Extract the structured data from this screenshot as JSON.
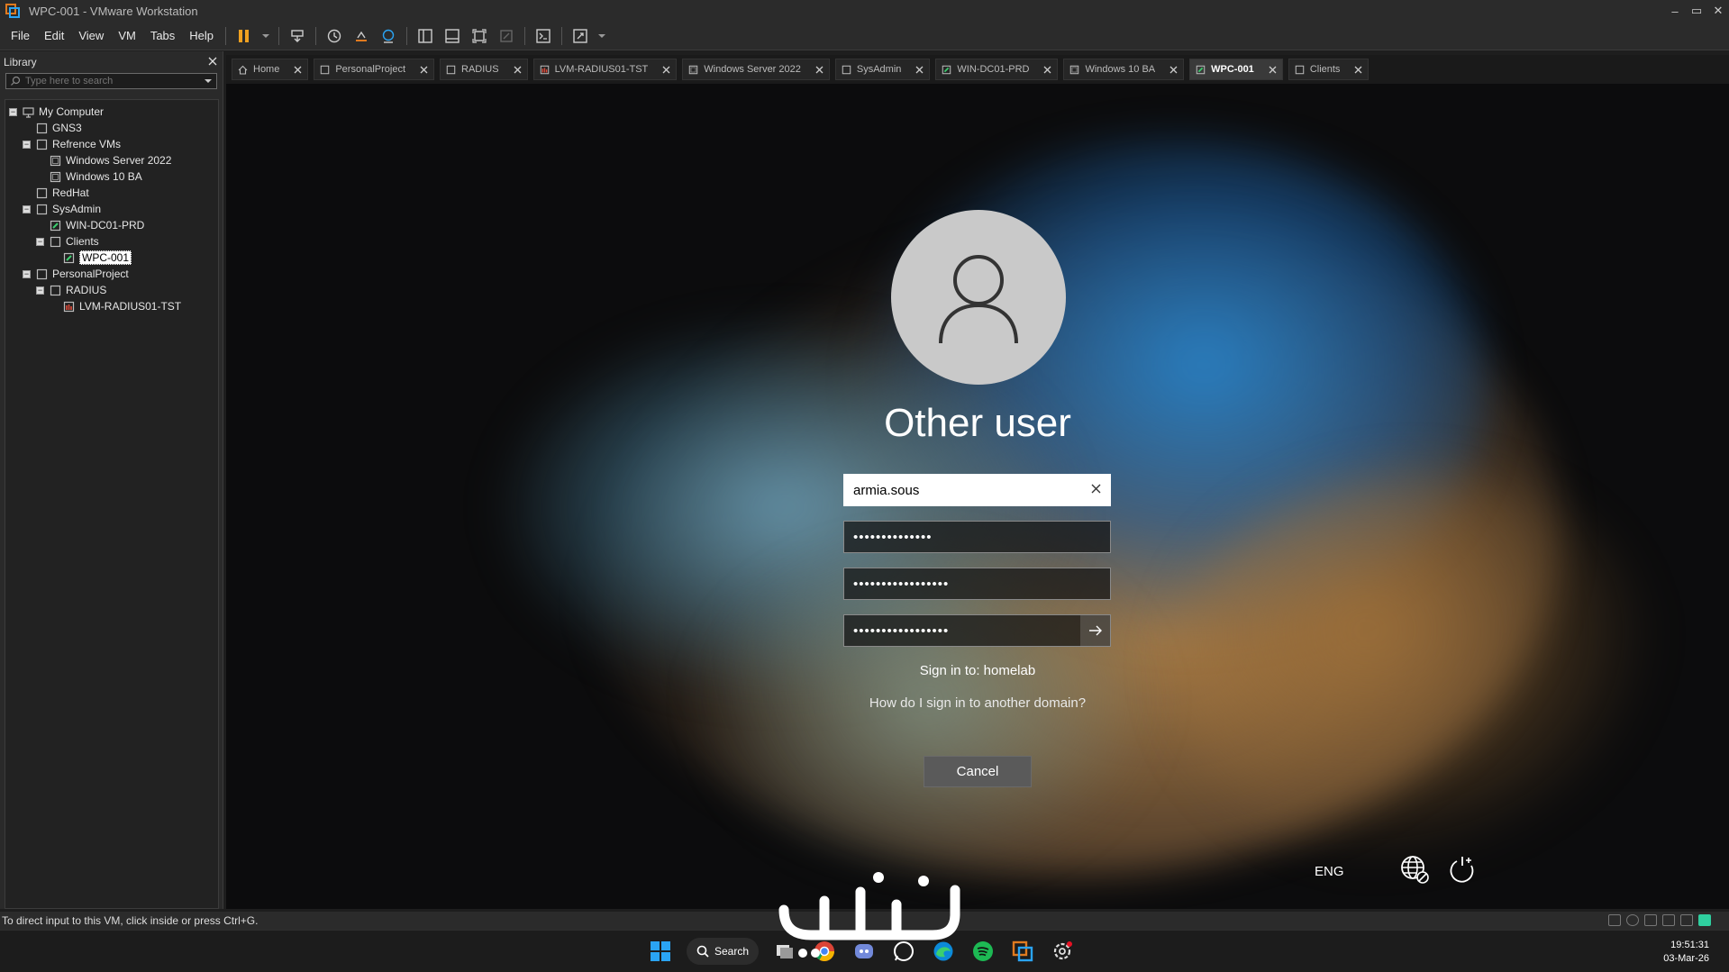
{
  "window": {
    "title": "WPC-001 - VMware Workstation",
    "controls": [
      "–",
      "▭",
      "✕"
    ]
  },
  "menu": [
    "File",
    "Edit",
    "View",
    "VM",
    "Tabs",
    "Help"
  ],
  "library": {
    "title": "Library",
    "search_placeholder": "Type here to search",
    "tree": [
      {
        "label": "My Computer",
        "level": 0,
        "toggle": "-",
        "icon": "computer-icon"
      },
      {
        "label": "GNS3",
        "level": 1,
        "toggle": "",
        "icon": "folder-icon"
      },
      {
        "label": "Refrence VMs",
        "level": 1,
        "toggle": "-",
        "icon": "folder-icon"
      },
      {
        "label": "Windows Server 2022",
        "level": 2,
        "toggle": "",
        "icon": "vm-icon"
      },
      {
        "label": "Windows 10 BA",
        "level": 2,
        "toggle": "",
        "icon": "vm-icon"
      },
      {
        "label": "RedHat",
        "level": 1,
        "toggle": "",
        "icon": "folder-icon"
      },
      {
        "label": "SysAdmin",
        "level": 1,
        "toggle": "-",
        "icon": "folder-icon"
      },
      {
        "label": "WIN-DC01-PRD",
        "level": 2,
        "toggle": "",
        "icon": "vm-running-icon"
      },
      {
        "label": "Clients",
        "level": 2,
        "toggle": "-",
        "icon": "folder-icon"
      },
      {
        "label": "WPC-001",
        "level": 3,
        "toggle": "",
        "icon": "vm-running-icon",
        "selected": true
      },
      {
        "label": "PersonalProject",
        "level": 1,
        "toggle": "-",
        "icon": "folder-icon"
      },
      {
        "label": "RADIUS",
        "level": 2,
        "toggle": "-",
        "icon": "folder-icon"
      },
      {
        "label": "LVM-RADIUS01-TST",
        "level": 3,
        "toggle": "",
        "icon": "vm-linux-icon"
      }
    ]
  },
  "tabs": [
    {
      "label": "Home",
      "icon": "home-icon",
      "active": false
    },
    {
      "label": "PersonalProject",
      "icon": "folder-icon",
      "active": false
    },
    {
      "label": "RADIUS",
      "icon": "folder-icon",
      "active": false
    },
    {
      "label": "LVM-RADIUS01-TST",
      "icon": "vm-linux-icon",
      "active": false
    },
    {
      "label": "Windows Server 2022",
      "icon": "vm-icon",
      "active": false
    },
    {
      "label": "SysAdmin",
      "icon": "folder-icon",
      "active": false
    },
    {
      "label": "WIN-DC01-PRD",
      "icon": "vm-running-icon",
      "active": false
    },
    {
      "label": "Windows 10 BA",
      "icon": "vm-icon",
      "active": false
    },
    {
      "label": "WPC-001",
      "icon": "vm-running-icon",
      "active": true
    },
    {
      "label": "Clients",
      "icon": "folder-icon",
      "active": false
    }
  ],
  "login": {
    "user_display": "Other user",
    "username_value": "armia.sous",
    "password1_value": "••••••••••••••",
    "password2_value": "•••••••••••••••••",
    "password3_value": "•••••••••••••••••",
    "sign_in_to": "Sign in to: homelab",
    "other_domain_link": "How do I sign in to another domain?",
    "cancel_label": "Cancel",
    "language": "ENG"
  },
  "status": {
    "hint": "To direct input to this VM, click inside or press Ctrl+G."
  },
  "taskbar": {
    "search_label": "Search",
    "time": "19:51:31",
    "date": "03-Mar-26"
  },
  "colors": {
    "vm_accent_orange": "#e07a1f",
    "pause_orange": "#f0a020",
    "windows_blue": "#2aa4f4",
    "spotify_green": "#1db954"
  }
}
